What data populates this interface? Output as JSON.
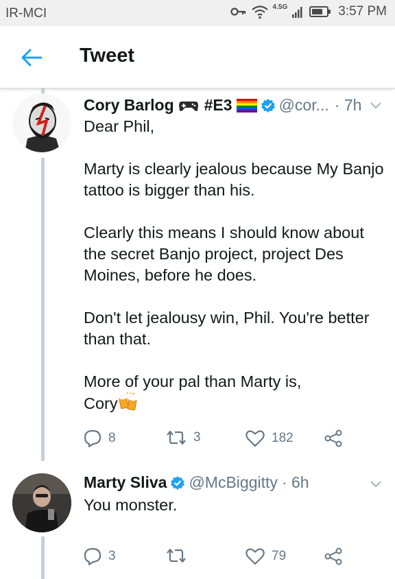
{
  "status_bar": {
    "carrier": "IR-MCI",
    "network": "4.5G",
    "time": "3:57 PM"
  },
  "header": {
    "title": "Tweet",
    "back_icon": "arrow-left-icon"
  },
  "colors": {
    "accent": "#1da1f2",
    "text": "#14171a",
    "muted": "#657786",
    "thread_line": "#c4cfd6"
  },
  "tweets": [
    {
      "name": "Cory Barlog",
      "name_tag": "#E3",
      "name_emojis": [
        "gamepad-icon",
        "rainbow-flag-icon"
      ],
      "verified": true,
      "handle": "@cor...",
      "time": "· 7h",
      "paragraphs": [
        "Dear Phil,",
        "Marty is clearly jealous because My Banjo tattoo is bigger than his.",
        "Clearly this means I should know about the secret Banjo project, project Des Moines, before he does.",
        "Don't let jealousy win, Phil. You're better than that.",
        "More of your pal than Marty is,"
      ],
      "signature": "Cory",
      "signature_emoji": "beer-mugs-icon",
      "replies": "8",
      "retweets": "3",
      "likes": "182"
    },
    {
      "name": "Marty Sliva",
      "verified": true,
      "handle": "@McBiggitty",
      "time": "· 6h",
      "text": "You monster.",
      "replies": "3",
      "retweets": "",
      "likes": "79"
    }
  ]
}
